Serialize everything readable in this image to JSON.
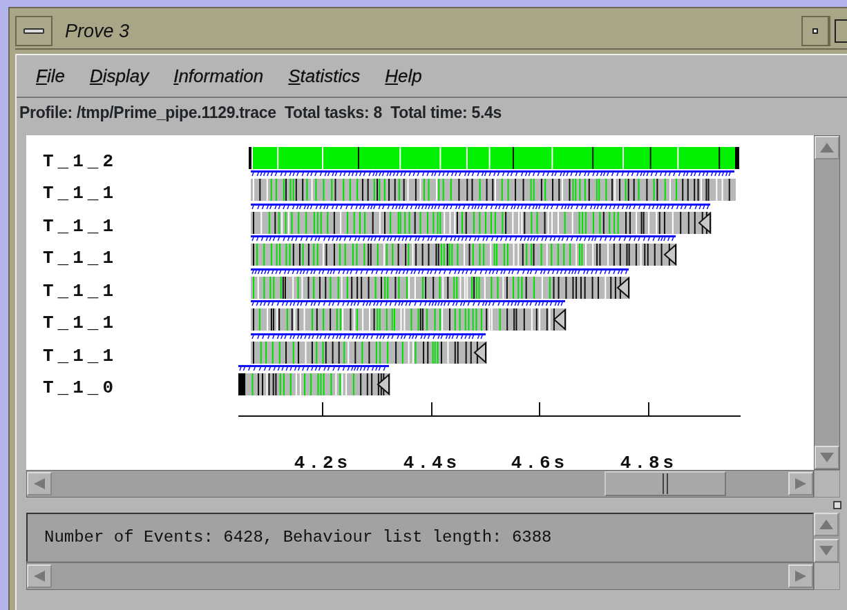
{
  "window": {
    "title": "Prove 3"
  },
  "menu": [
    {
      "label": "File"
    },
    {
      "label": "Display"
    },
    {
      "label": "Information"
    },
    {
      "label": "Statistics"
    },
    {
      "label": "Help"
    }
  ],
  "profile_line": "Profile: /tmp/Prime_pipe.1129.trace  Total tasks: 8  Total time: 5.4s",
  "trace": {
    "tasks": [
      "T_1_2",
      "T_1_1",
      "T_1_1",
      "T_1_1",
      "T_1_1",
      "T_1_1",
      "T_1_1",
      "T_1_0"
    ],
    "axis_labels": [
      "4.2s",
      "4.4s",
      "4.6s",
      "4.8s"
    ]
  },
  "status": {
    "message": "Number of Events: 6428, Behaviour list length: 6388"
  }
}
